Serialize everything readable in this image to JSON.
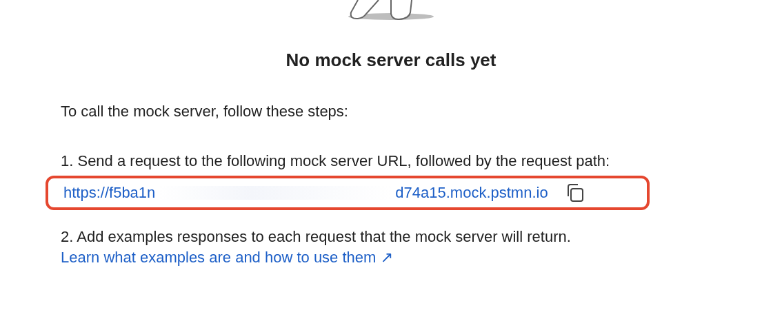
{
  "empty_state": {
    "title": "No mock server calls yet"
  },
  "intro": "To call the mock server, follow these steps:",
  "steps": [
    {
      "text": "1. Send a request to the following mock server URL, followed by the request path:",
      "url_start": "https://f5ba1n",
      "url_end": "d74a15.mock.pstmn.io",
      "highlighted": true
    },
    {
      "text": "2. Add examples responses to each request that the mock server will return.",
      "link": "Learn what examples are and how to use them ↗"
    }
  ]
}
